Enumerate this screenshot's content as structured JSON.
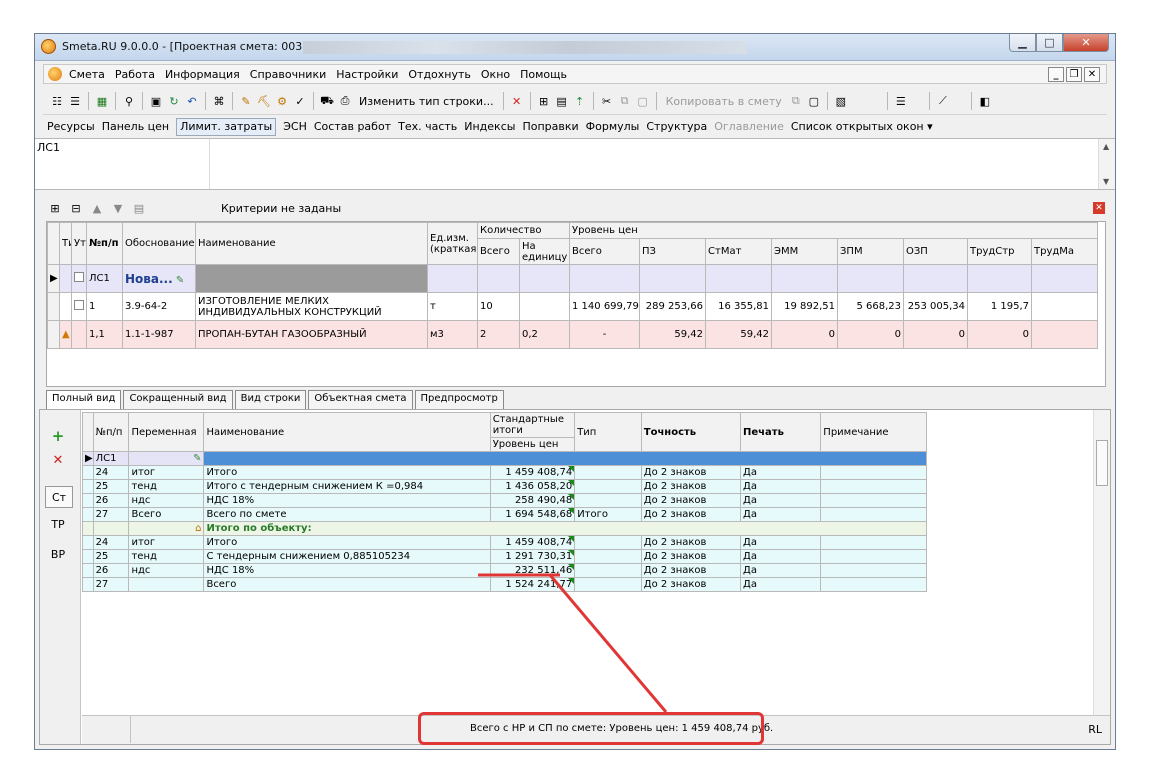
{
  "title": "Smeta.RU  9.0.0.0  - [Проектная смета: 003",
  "menu": [
    "Смета",
    "Работа",
    "Информация",
    "Справочники",
    "Настройки",
    "Отдохнуть",
    "Окно",
    "Помощь"
  ],
  "toolbar": {
    "change_row_type": "Изменить тип строки...",
    "copy_to_estimate": "Копировать в смету"
  },
  "tabs": [
    "Ресурсы",
    "Панель цен",
    "Лимит. затраты",
    "ЭСН",
    "Состав работ",
    "Тех. часть",
    "Индексы",
    "Поправки",
    "Формулы",
    "Структура",
    "Оглавление",
    "Список открытых окон ▾"
  ],
  "tree_node": "ЛС1",
  "criteria": "Критерии не заданы",
  "grid1": {
    "headers": {
      "ti": "Ти",
      "ut": "Ут",
      "num": "№п/п",
      "basis": "Обоснование",
      "name": "Наименование",
      "unit": "Ед.изм. (краткая)",
      "qty": "Количество",
      "qty_all": "Всего",
      "qty_per": "На единицу",
      "price_level": "Уровень цен",
      "all": "Всего",
      "pz": "ПЗ",
      "stmat": "СтМат",
      "emm": "ЭММ",
      "zpm": "ЗПМ",
      "ozp": "ОЗП",
      "trudstr": "ТрудСтр",
      "trudma": "ТрудМа"
    },
    "rows": [
      {
        "num": "ЛС1",
        "basis": "Нова...",
        "name": "",
        "unit": "",
        "qty_all": "",
        "qty_per": "",
        "all": "",
        "pz": "",
        "stmat": "",
        "emm": "",
        "zpm": "",
        "ozp": "",
        "trudstr": ""
      },
      {
        "num": "1",
        "basis": "3.9-64-2",
        "name": "ИЗГОТОВЛЕНИЕ МЕЛКИХ",
        "name2": "ИНДИВИДУАЛЬНЫХ КОНСТРУКЦИЙ",
        "unit": "т",
        "qty_all": "10",
        "qty_per": "",
        "all": "1 140 699,79",
        "pz": "289 253,66",
        "stmat": "16 355,81",
        "emm": "19 892,51",
        "zpm": "5 668,23",
        "ozp": "253 005,34",
        "trudstr": "1 195,7"
      },
      {
        "num": "1,1",
        "basis": "1.1-1-987",
        "name": "ПРОПАН-БУТАН ГАЗООБРАЗНЫЙ",
        "unit": "м3",
        "qty_all": "2",
        "qty_per": "0,2",
        "all": "-",
        "pz": "59,42",
        "stmat": "59,42",
        "emm": "0",
        "zpm": "0",
        "ozp": "0",
        "trudstr": "0"
      }
    ]
  },
  "view_tabs": [
    "Полный вид",
    "Сокращенный вид",
    "Вид строки",
    "Объектная смета",
    "Предпросмотр"
  ],
  "side_buttons": [
    "Ст",
    "ТР",
    "ВР"
  ],
  "grid2": {
    "headers": {
      "num": "№п/п",
      "var": "Переменная",
      "name": "Наименование",
      "std": "Стандартные итоги",
      "level": "Уровень цен",
      "type": "Тип",
      "prec": "Точность",
      "print": "Печать",
      "note": "Примечание"
    },
    "ls_label": "ЛС1",
    "rows_a": [
      {
        "num": "24",
        "var": "итог",
        "name": "Итого",
        "val": "1 459 408,74",
        "type": "",
        "prec": "До 2 знаков",
        "print": "Да"
      },
      {
        "num": "25",
        "var": "тенд",
        "name": "Итого с тендерным снижением К =0,984",
        "val": "1 436 058,20",
        "type": "",
        "prec": "До 2 знаков",
        "print": "Да"
      },
      {
        "num": "26",
        "var": "ндс",
        "name": "НДС 18%",
        "val": "258 490,48",
        "type": "",
        "prec": "До 2 знаков",
        "print": "Да"
      },
      {
        "num": "27",
        "var": "Всего",
        "name": "Всего по смете",
        "val": "1 694 548,68",
        "type": "Итого",
        "prec": "До 2 знаков",
        "print": "Да"
      }
    ],
    "object_label": "Итого по объекту:",
    "rows_b": [
      {
        "num": "24",
        "var": "итог",
        "name": "Итого",
        "val": "1 459 408,74",
        "type": "",
        "prec": "До 2 знаков",
        "print": "Да"
      },
      {
        "num": "25",
        "var": "тенд",
        "name": "С тендерным снижением 0,885105234",
        "val": "1 291 730,31",
        "type": "",
        "prec": "До 2 знаков",
        "print": "Да"
      },
      {
        "num": "26",
        "var": "ндс",
        "name": "НДС 18%",
        "val": "232 511,46",
        "type": "",
        "prec": "До 2 знаков",
        "print": "Да"
      },
      {
        "num": "27",
        "var": "",
        "name": "Всего",
        "val": "1 524 241,77",
        "type": "",
        "prec": "До 2 знаков",
        "print": "Да"
      }
    ]
  },
  "status": {
    "total": "Всего с НР и СП по смете: Уровень цен: 1 459 408,74 руб.",
    "lang": "RL"
  }
}
